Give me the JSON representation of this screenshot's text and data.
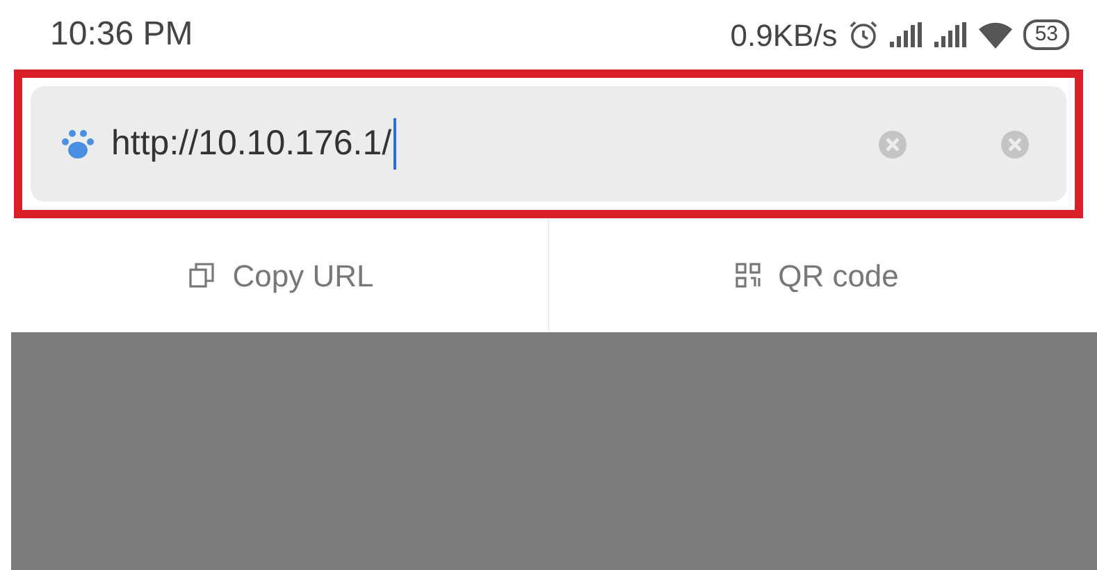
{
  "status_bar": {
    "time": "10:36 PM",
    "speed": "0.9KB/s",
    "battery": "53"
  },
  "address_bar": {
    "value": "http://10.10.176.1/"
  },
  "actions": [
    {
      "kind": "copy",
      "label": "Copy URL"
    },
    {
      "kind": "qr",
      "label": "QR code"
    }
  ]
}
